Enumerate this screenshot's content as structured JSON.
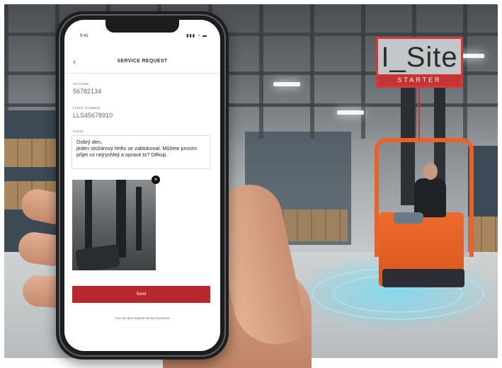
{
  "sign": {
    "title": "I_Site",
    "subtitle": "STARTER"
  },
  "status_bar": {
    "time": "9:41",
    "icons": "▮▮▮ ◔ ▬"
  },
  "screen": {
    "title": "SERVICE REQUEST",
    "back_icon": "chevron-left-icon",
    "fields": [
      {
        "label": "MACHINE",
        "value": "56782134"
      },
      {
        "label": "FLEET NUMBER",
        "value": "LLS45678910"
      }
    ],
    "issue_label": "ISSUE",
    "issue_text": "Dobrý den,\njeden stožárový řetěz se zablokoval. Můžete prosím přijet co nejrychleji a opravit to? Děkuji.",
    "photo_remove_icon": "close-icon",
    "send_label": "Send",
    "note": "You can also request service by phone"
  },
  "colors": {
    "accent": "#b7282e",
    "forklift": "#e8632a",
    "glow": "#78dcf5"
  }
}
